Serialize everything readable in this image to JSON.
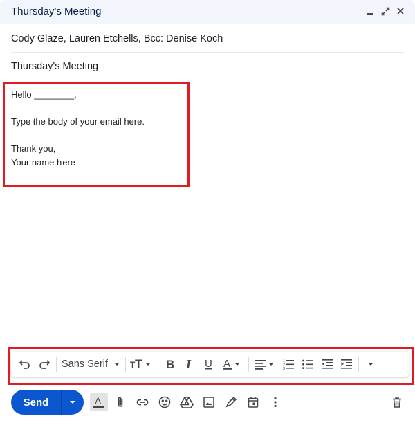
{
  "window": {
    "title": "Thursday's Meeting",
    "controls": [
      "minimize-icon",
      "expand-icon",
      "close-icon"
    ]
  },
  "recipients": "Cody Glaze, Lauren Etchells, Bcc: Denise Koch",
  "subject": "Thursday's Meeting",
  "body": {
    "greeting": "Hello ________,",
    "paragraph": "Type the body of your email here.",
    "closing": "Thank you,",
    "signature_before_caret": "Your name h",
    "signature_after_caret": "ere"
  },
  "toolbar": {
    "font_family": "Sans Serif",
    "buttons": [
      "undo-icon",
      "redo-icon",
      "font-select",
      "text-size-icon",
      "bold-icon",
      "italic-icon",
      "underline-icon",
      "text-color-icon",
      "align-icon",
      "numbered-list-icon",
      "bulleted-list-icon",
      "indent-less-icon",
      "indent-more-icon",
      "more-formatting-icon"
    ]
  },
  "actions": {
    "send_label": "Send",
    "icons": [
      "schedule-send-arrow",
      "formatting-options-icon",
      "attach-icon",
      "link-icon",
      "emoji-icon",
      "drive-icon",
      "photo-icon",
      "signature-icon",
      "calendar-icon",
      "more-options-icon",
      "delete-icon"
    ]
  },
  "colors": {
    "accent": "#0b57d0",
    "titlebar_bg": "#f2f6fc",
    "highlight": "#e01b24"
  }
}
